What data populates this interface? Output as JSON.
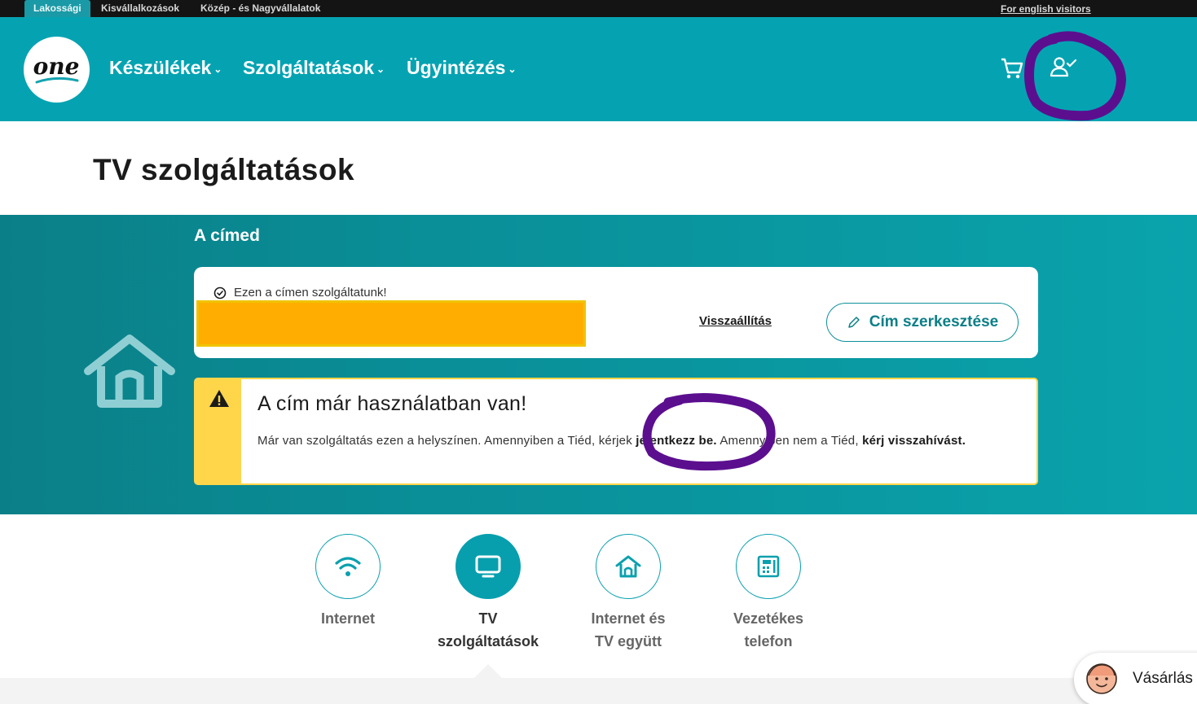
{
  "topbar": {
    "segments": [
      "Lakossági",
      "Kisvállalkozások",
      "Közép - és Nagyvállalatok"
    ],
    "english_link": "For english visitors"
  },
  "header": {
    "logo_text": "one",
    "nav": [
      "Készülékek",
      "Szolgáltatások",
      "Ügyintézés"
    ],
    "cart_icon": "shopping-cart-icon",
    "user_icon": "user-check-icon"
  },
  "page": {
    "title": "TV szolgáltatások"
  },
  "address": {
    "heading": "A címed",
    "served_text": "Ezen a címen szolgáltatunk!",
    "reset_link": "Visszaállítás",
    "edit_button": "Cím szerkesztése"
  },
  "warning": {
    "title": "A cím már használatban van!",
    "text_before": "Már van szolgáltatás ezen a helyszínen. Amennyiben a Tiéd, kérjek ",
    "login_link": "jelentkezz be.",
    "text_middle": " Amennyiben nem a Tiéd, ",
    "callback_link": "kérj visszahívást."
  },
  "services": [
    {
      "label": "Internet",
      "icon": "wifi-icon"
    },
    {
      "label": "TV szolgáltatások",
      "icon": "tv-icon"
    },
    {
      "label": "Internet és TV együtt",
      "icon": "home-icon"
    },
    {
      "label": "Vezetékes telefon",
      "icon": "phone-icon"
    }
  ],
  "chat": {
    "label": "Vásárlás"
  },
  "colors": {
    "brand_teal": "#05a3b2",
    "band_teal": "#0a8e97",
    "warning_yellow": "#ffd54a",
    "annotation_purple": "#5b0f8f",
    "redaction_orange": "#ffae00"
  }
}
